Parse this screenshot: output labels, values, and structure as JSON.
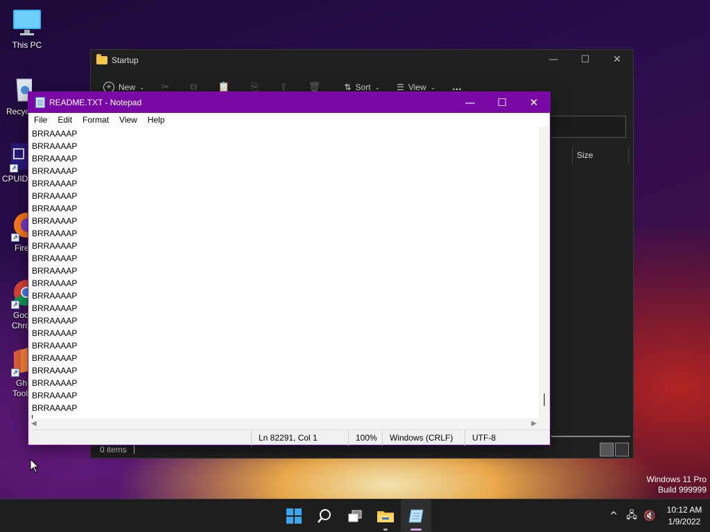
{
  "desktop": {
    "icons": [
      {
        "label": "This PC"
      },
      {
        "label": "Recyc"
      },
      {
        "label": "CPUID"
      },
      {
        "label": "Fire"
      },
      {
        "label": "Goo",
        "label2": "Chro"
      },
      {
        "label": "Gh",
        "label2": "Tool"
      }
    ],
    "watermark": {
      "line1": "Windows 11 Pro",
      "line2": "Build 999999"
    }
  },
  "explorer": {
    "title": "Startup",
    "toolbar": {
      "new_label": "New",
      "sort_label": "Sort",
      "view_label": "View",
      "more_label": "..."
    },
    "column_size": "Size",
    "status_items": "0 items"
  },
  "notepad": {
    "title": "README.TXT - Notepad",
    "menu": [
      "File",
      "Edit",
      "Format",
      "View",
      "Help"
    ],
    "lines": [
      "BRRAAAAP",
      "BRRAAAAP",
      "BRRAAAAP",
      "BRRAAAAP",
      "BRRAAAAP",
      "BRRAAAAP",
      "BRRAAAAP",
      "BRRAAAAP",
      "BRRAAAAP",
      "BRRAAAAP",
      "BRRAAAAP",
      "BRRAAAAP",
      "BRRAAAAP",
      "BRRAAAAP",
      "BRRAAAAP",
      "BRRAAAAP",
      "BRRAAAAP",
      "BRRAAAAP",
      "BRRAAAAP",
      "BRRAAAAP",
      "BRRAAAAP",
      "BRRAAAAP",
      "BRRAAAAP"
    ],
    "status": {
      "position": "Ln 82291, Col 1",
      "zoom": "100%",
      "line_ending": "Windows (CRLF)",
      "encoding": "UTF-8"
    },
    "accent_color": "#7a0aa6"
  },
  "taskbar": {
    "clock_time": "10:12 AM",
    "clock_date": "1/9/2022",
    "tray_chevron": "^"
  }
}
